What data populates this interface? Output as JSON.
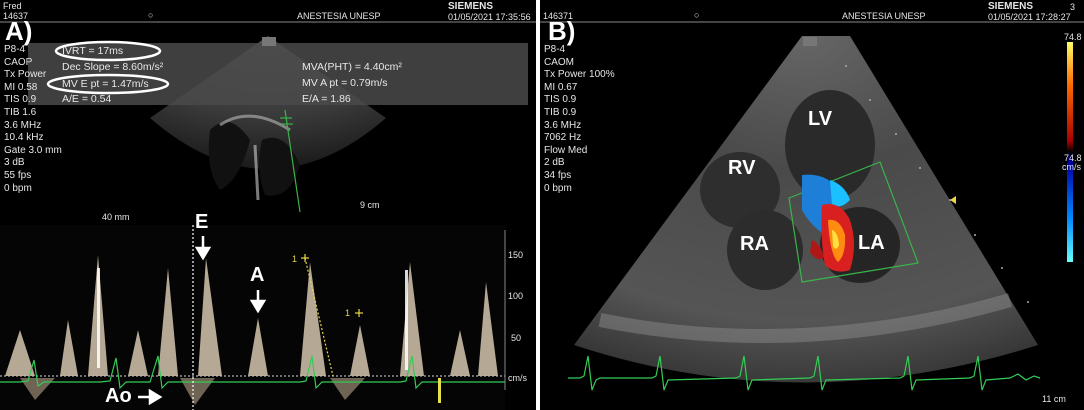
{
  "panel_a": {
    "label": "A)",
    "user": "Fred",
    "patient_id": "14637",
    "institution": "ANESTESIA UNESP",
    "vendor": "SIEMENS",
    "datetime": "01/05/2021 17:35:56",
    "params": [
      "P8-4",
      "CAOP",
      "Tx Power",
      "MI 0.58",
      "TIS 0.9",
      "TIB 1.6",
      "3.6 MHz",
      "10.4 kHz",
      "Gate 3.0 mm",
      "3 dB",
      "55 fps",
      "0 bpm"
    ],
    "measurements": {
      "ivrt": "IVRT = 17ms",
      "dec_slope": "Dec Slope = 8.60m/s²",
      "mv_e": "MV E pt = 1.47m/s",
      "a_e": "A/E = 0.54",
      "mva": "MVA(PHT) = 4.40cm²",
      "mv_a": "MV A pt = 0.79m/s",
      "e_a": "E/A = 1.86"
    },
    "depth": "9 cm",
    "sweep_label": "40 mm",
    "scale_ticks": [
      "150",
      "100",
      "50"
    ],
    "scale_unit": "cm/s",
    "wave_labels": {
      "e": "E",
      "a": "A",
      "ao": "Ao"
    },
    "cursor_marks": [
      "1",
      "1"
    ]
  },
  "panel_b": {
    "label": "B)",
    "patient_id": "146371",
    "institution": "ANESTESIA UNESP",
    "vendor": "SIEMENS",
    "datetime": "01/05/2021 17:28:27",
    "corner_num": "3",
    "params": [
      "P8-4",
      "CAOM",
      "Tx Power 100%",
      "MI 0.67",
      "TIS 0.9",
      "TIB 0.9",
      "3.6 MHz",
      "7062 Hz",
      "Flow Med",
      "2 dB",
      "34 fps",
      "0 bpm"
    ],
    "chambers": {
      "lv": "LV",
      "rv": "RV",
      "ra": "RA",
      "la": "LA"
    },
    "color_scale_top": "74.8",
    "color_scale_bottom": "74.8",
    "color_scale_unit": "cm/s",
    "depth": "11 cm"
  }
}
